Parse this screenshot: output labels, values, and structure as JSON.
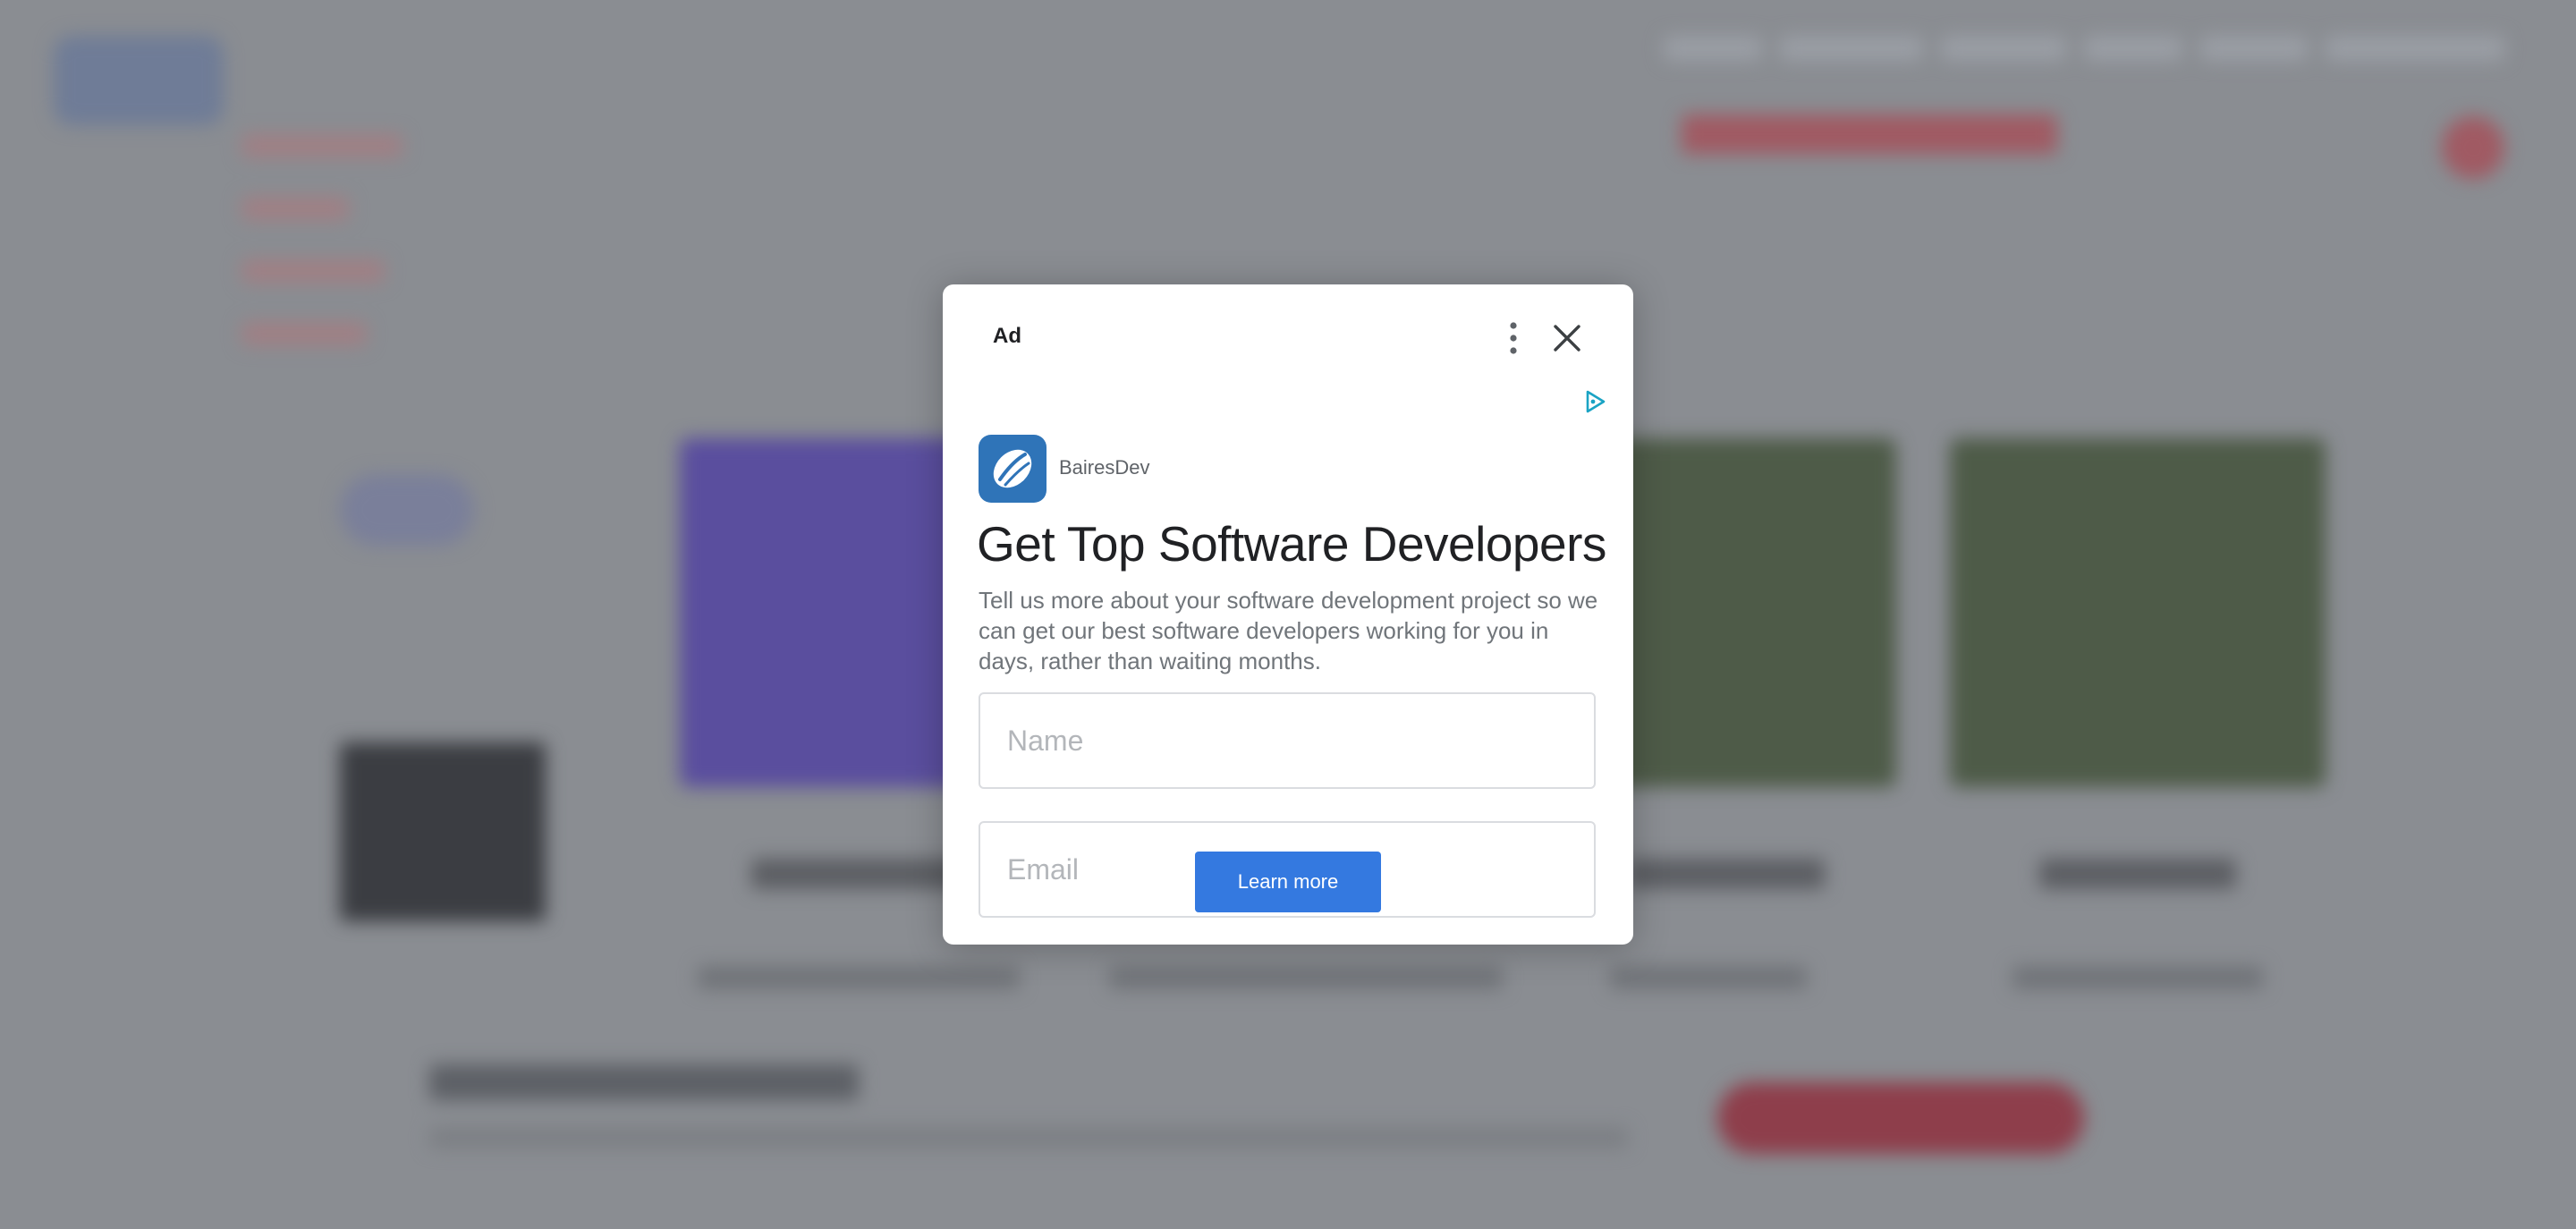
{
  "modal": {
    "ad_label": "Ad",
    "icons": [
      "more-vertical-icon",
      "close-icon",
      "adchoices-icon"
    ],
    "brand": {
      "name": "BairesDev",
      "logo_icon": "bairesdev-logo",
      "color": "#2f74b8"
    },
    "headline": "Get Top Software Developers",
    "description": "Tell us more about your software development project so we can get our best software developers working for you in days, rather than waiting months.",
    "form": {
      "name_placeholder": "Name",
      "name_value": "",
      "email_placeholder": "Email",
      "email_value": ""
    },
    "cta_label": "Learn more",
    "accent_color": "#3479e0"
  }
}
